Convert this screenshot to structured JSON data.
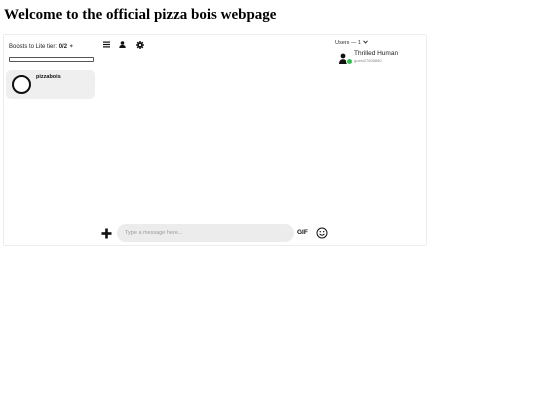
{
  "page": {
    "title": "Welcome to the official pizza bois webpage"
  },
  "sidebar": {
    "boost_label": "Boosts to Lite tier:",
    "boost_count": "0/2",
    "boost_progress": 0,
    "servers": [
      {
        "name": "pizzabois"
      }
    ]
  },
  "toolbar": {
    "icons": [
      "menu-icon",
      "user-icon",
      "gear-icon"
    ]
  },
  "users_panel": {
    "header": "Users — 1",
    "users": [
      {
        "name": "Thrilled Human",
        "id": "guest27608880",
        "status_color": "#31c251"
      }
    ]
  },
  "composer": {
    "placeholder": "Type a message here...",
    "gif_label": "GIF",
    "icons": [
      "plus-icon",
      "emoji-icon"
    ]
  },
  "colors": {
    "online": "#31c251",
    "input_bg": "#ececec",
    "server_item_bg": "#efefef"
  }
}
